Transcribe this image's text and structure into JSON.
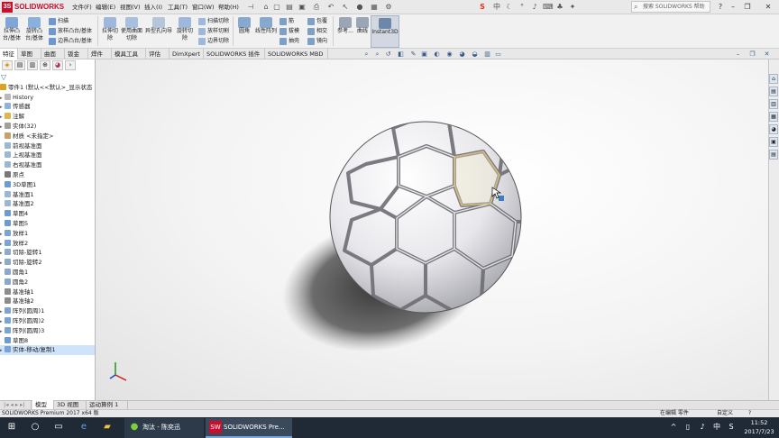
{
  "app": {
    "logo_text": "SOLIDWORKS",
    "logo_mark": "3S"
  },
  "menu": [
    "文件(F)",
    "编辑(E)",
    "视图(V)",
    "插入(I)",
    "工具(T)",
    "窗口(W)",
    "帮助(H)"
  ],
  "search": {
    "placeholder": "搜索 SOLIDWORKS 帮助"
  },
  "ribbon": {
    "extrude_boss": "拉伸凸台/基体",
    "revolve_boss": "旋转凸台/基体",
    "sweep": "扫描",
    "loft_boss": "放样凸台/基体",
    "boundary_boss": "边界凸台/基体",
    "extrude_cut": "拉伸切除",
    "hole_wizard": "异型孔向导",
    "revolve_cut": "旋转切除",
    "swept_cut": "扫描切除",
    "lofted_cut": "放样切割",
    "boundary_cut": "边界切除",
    "surface_cut": "使用曲面切除",
    "fillet": "圆角",
    "linear_pattern": "线性阵列",
    "rib": "筋",
    "draft": "拔模",
    "shell": "抽壳",
    "wrap": "包覆",
    "intersect": "相交",
    "mirror": "镜向",
    "reference_geometry": "参考...",
    "curves": "曲线",
    "instant3d": "Instant3D"
  },
  "tabs": [
    "特征",
    "草图",
    "曲面",
    "钣金",
    "焊件",
    "模具工具",
    "评估",
    "DimXpert",
    "SOLIDWORKS 插件",
    "SOLIDWORKS MBD"
  ],
  "tree": {
    "root": "零件1 (默认<<默认>_显示状态",
    "items": [
      "History",
      "传感器",
      "注解",
      "实体(32)",
      "材质 <未指定>",
      "前视基准面",
      "上视基准面",
      "右视基准面",
      "原点",
      "3D草图1",
      "基准面1",
      "基准面2",
      "草图4",
      "草图5",
      "放样1",
      "放样2",
      "切除-旋转1",
      "切除-旋转2",
      "圆角1",
      "圆角2",
      "基准轴1",
      "基准轴2",
      "阵列(圆周)1",
      "阵列(圆周)2",
      "阵列(圆周)3",
      "草图8",
      "实体-移动/复制1"
    ]
  },
  "bottom_tabs": [
    "模型",
    "3D 视图",
    "运动算例 1"
  ],
  "status": {
    "app_version": "SOLIDWORKS Premium 2017 x64 版",
    "editing": "在编辑 零件",
    "custom": "自定义"
  },
  "taskbar": {
    "task1": "淘汰 - 陈奕迅",
    "task2": "SOLIDWORKS Pre...",
    "time": "11:52",
    "date": "2017/7/23"
  },
  "colors": {
    "accent": "#c8102e",
    "selection": "#cfe3fb",
    "taskbar": "#1f2a36"
  }
}
